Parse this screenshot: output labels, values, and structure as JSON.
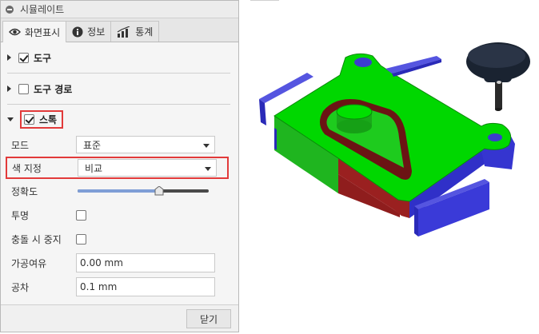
{
  "panel": {
    "title": "시뮬레이트",
    "tabs": [
      {
        "label": "화면표시",
        "icon": "eye-icon",
        "active": true
      },
      {
        "label": "정보",
        "icon": "info-icon",
        "active": false
      },
      {
        "label": "통계",
        "icon": "statistics-icon",
        "active": false
      }
    ],
    "sections": {
      "tool": {
        "label": "도구",
        "checked": true,
        "expanded": false
      },
      "toolpath": {
        "label": "도구 경로",
        "checked": false,
        "expanded": false
      },
      "stock": {
        "label": "스톡",
        "checked": true,
        "expanded": true
      }
    },
    "fields": {
      "mode": {
        "label": "모드",
        "value": "표준"
      },
      "colorization": {
        "label": "색 지정",
        "value": "비교"
      },
      "accuracy": {
        "label": "정확도",
        "value": 0.62
      },
      "transparent": {
        "label": "투명",
        "checked": false
      },
      "stop_on_collision": {
        "label": "충돌 시 중지",
        "checked": false
      },
      "stock_offset": {
        "label": "가공여유",
        "value": "0.00 mm"
      },
      "tolerance": {
        "label": "공차",
        "value": "0.1 mm"
      }
    },
    "close_label": "닫기"
  },
  "colors": {
    "highlight": "#e23a3a",
    "stock_green": "#00d700",
    "stock_red": "#8f1d1d",
    "fixture_blue": "#3a3ad8",
    "slider_fill": "#7f9ed6"
  }
}
